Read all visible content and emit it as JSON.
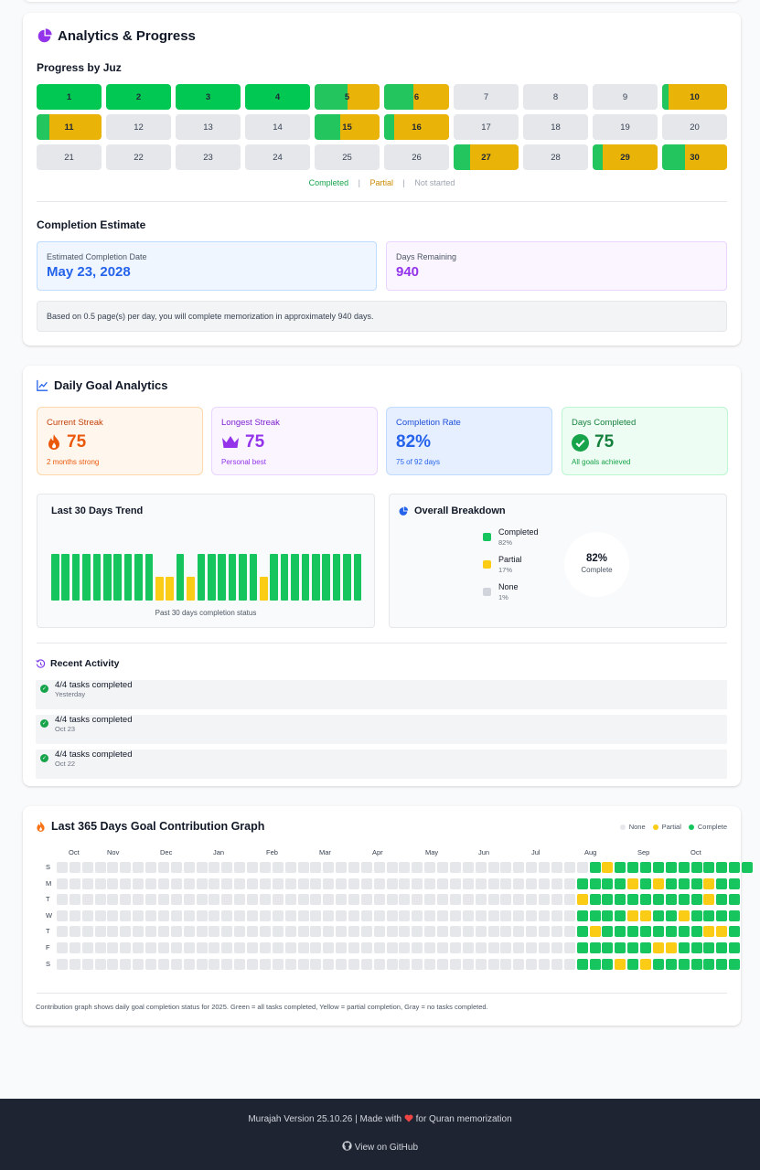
{
  "analytics": {
    "title": "Analytics & Progress",
    "juz_heading": "Progress by Juz",
    "juz": [
      {
        "n": "1",
        "status": "complete",
        "progress": 1
      },
      {
        "n": "2",
        "status": "complete",
        "progress": 1
      },
      {
        "n": "3",
        "status": "complete",
        "progress": 1
      },
      {
        "n": "4",
        "status": "complete",
        "progress": 1
      },
      {
        "n": "5",
        "status": "partial",
        "progress": 0.5
      },
      {
        "n": "6",
        "status": "partial",
        "progress": 0.45
      },
      {
        "n": "7",
        "status": "none",
        "progress": 0
      },
      {
        "n": "8",
        "status": "none",
        "progress": 0
      },
      {
        "n": "9",
        "status": "none",
        "progress": 0
      },
      {
        "n": "10",
        "status": "partial",
        "progress": 0.1
      },
      {
        "n": "11",
        "status": "partial",
        "progress": 0.2
      },
      {
        "n": "12",
        "status": "none",
        "progress": 0
      },
      {
        "n": "13",
        "status": "none",
        "progress": 0
      },
      {
        "n": "14",
        "status": "none",
        "progress": 0
      },
      {
        "n": "15",
        "status": "partial",
        "progress": 0.4
      },
      {
        "n": "16",
        "status": "partial",
        "progress": 0.15
      },
      {
        "n": "17",
        "status": "none",
        "progress": 0
      },
      {
        "n": "18",
        "status": "none",
        "progress": 0
      },
      {
        "n": "19",
        "status": "none",
        "progress": 0
      },
      {
        "n": "20",
        "status": "none",
        "progress": 0
      },
      {
        "n": "21",
        "status": "none",
        "progress": 0
      },
      {
        "n": "22",
        "status": "none",
        "progress": 0
      },
      {
        "n": "23",
        "status": "none",
        "progress": 0
      },
      {
        "n": "24",
        "status": "none",
        "progress": 0
      },
      {
        "n": "25",
        "status": "none",
        "progress": 0
      },
      {
        "n": "26",
        "status": "none",
        "progress": 0
      },
      {
        "n": "27",
        "status": "partial",
        "progress": 0.25
      },
      {
        "n": "28",
        "status": "none",
        "progress": 0
      },
      {
        "n": "29",
        "status": "partial",
        "progress": 0.15
      },
      {
        "n": "30",
        "status": "partial",
        "progress": 0.35
      }
    ],
    "legend": {
      "completed": "Completed",
      "partial": "Partial",
      "not_started": "Not started",
      "sep": "|"
    },
    "estimate_heading": "Completion Estimate",
    "est_date_label": "Estimated Completion Date",
    "est_date_value": "May 23, 2028",
    "days_remaining_label": "Days Remaining",
    "days_remaining_value": "940",
    "note": "Based on 0.5 page(s) per day, you will complete memorization in approximately 940 days."
  },
  "daily": {
    "title": "Daily Goal Analytics",
    "stats": [
      {
        "label": "Current Streak",
        "value": "75",
        "sub": "2 months strong",
        "icon": "flame-icon"
      },
      {
        "label": "Longest Streak",
        "value": "75",
        "sub": "Personal best",
        "icon": "crown-icon"
      },
      {
        "label": "Completion Rate",
        "value": "82%",
        "sub": "75 of 92 days",
        "icon": ""
      },
      {
        "label": "Days Completed",
        "value": "75",
        "sub": "All goals achieved",
        "icon": "check-circle-icon"
      }
    ],
    "trend_title": "Last 30 Days Trend",
    "trend_caption": "Past 30 days completion status",
    "trend": [
      "c",
      "c",
      "c",
      "c",
      "c",
      "c",
      "c",
      "c",
      "c",
      "c",
      "p",
      "p",
      "c",
      "p",
      "c",
      "c",
      "c",
      "c",
      "c",
      "c",
      "p",
      "c",
      "c",
      "c",
      "c",
      "c",
      "c",
      "c",
      "c",
      "c"
    ],
    "breakdown_title": "Overall Breakdown",
    "breakdown": [
      {
        "label": "Completed",
        "pct": "82%",
        "color": "#16c55e"
      },
      {
        "label": "Partial",
        "pct": "17%",
        "color": "#facc15"
      },
      {
        "label": "None",
        "pct": "1%",
        "color": "#d1d5db"
      }
    ],
    "donut_value": "82%",
    "donut_label": "Complete",
    "recent_title": "Recent Activity",
    "recent": [
      {
        "text": "4/4 tasks completed",
        "date": "Yesterday"
      },
      {
        "text": "4/4 tasks completed",
        "date": "Oct 23"
      },
      {
        "text": "4/4 tasks completed",
        "date": "Oct 22"
      }
    ]
  },
  "contrib": {
    "title": "Last 365 Days Goal Contribution Graph",
    "legend": {
      "none": "None",
      "partial": "Partial",
      "complete": "Complete"
    },
    "months": [
      "Oct",
      "Nov",
      "Dec",
      "Jan",
      "Feb",
      "Mar",
      "Apr",
      "May",
      "Jun",
      "Jul",
      "Aug",
      "Sep",
      "Oct"
    ],
    "days": [
      "S",
      "M",
      "T",
      "W",
      "T",
      "F",
      "S"
    ],
    "recent_weeks": [
      [
        "c",
        "p",
        "c",
        "c",
        "c",
        "c",
        "c",
        "c",
        "c",
        "c",
        "c",
        "c",
        "c"
      ],
      [
        "c",
        "c",
        "c",
        "c",
        "p",
        "c",
        "p",
        "c",
        "c",
        "c",
        "p",
        "c",
        "c"
      ],
      [
        "p",
        "c",
        "c",
        "c",
        "c",
        "c",
        "c",
        "c",
        "c",
        "c",
        "p",
        "c",
        "c"
      ],
      [
        "c",
        "c",
        "c",
        "c",
        "p",
        "p",
        "c",
        "c",
        "p",
        "c",
        "c",
        "c",
        "c"
      ],
      [
        "c",
        "p",
        "c",
        "c",
        "c",
        "c",
        "c",
        "c",
        "c",
        "c",
        "p",
        "p",
        "c"
      ],
      [
        "c",
        "c",
        "c",
        "c",
        "c",
        "c",
        "p",
        "p",
        "c",
        "c",
        "c",
        "c",
        "c"
      ],
      [
        "c",
        "c",
        "c",
        "p",
        "c",
        "p",
        "c",
        "c",
        "c",
        "c",
        "c",
        "c",
        "c"
      ]
    ],
    "caption": "Contribution graph shows daily goal completion status for 2025. Green = all tasks completed, Yellow = partial completion, Gray = no tasks completed."
  },
  "footer": {
    "version_text": "Murajah Version 25.10.26 | Made with",
    "for_text": "for Quran memorization",
    "github": "View on GitHub"
  },
  "colors": {
    "complete": "#16c55e",
    "partial": "#eab308",
    "none": "#e5e7eb",
    "accent_purple": "#9333ea",
    "accent_blue": "#2563eb"
  }
}
